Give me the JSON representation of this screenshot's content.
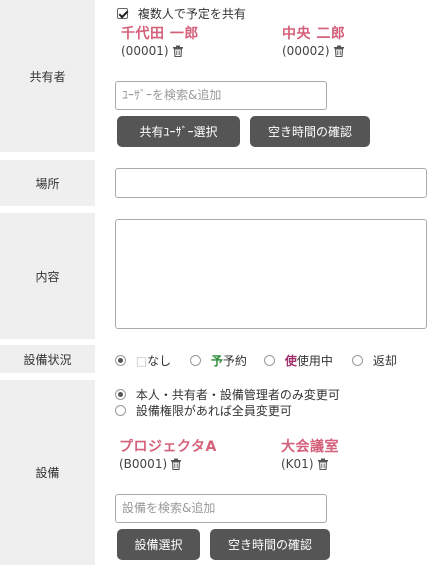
{
  "sharer": {
    "label": "共有者",
    "share_checkbox_label": "複数人で予定を共有",
    "people": [
      {
        "name": "千代田 一郎",
        "code": "(00001)"
      },
      {
        "name": "中央 二郎",
        "code": "(00002)"
      }
    ],
    "search_placeholder": "ﾕｰｻﾞｰを検索&追加",
    "select_button": "共有ﾕｰｻﾞｰ選択",
    "availability_button": "空き時間の確認"
  },
  "place": {
    "label": "場所",
    "value": ""
  },
  "content": {
    "label": "内容",
    "value": ""
  },
  "equipment_status": {
    "label": "設備状況",
    "options": [
      {
        "mark": "□",
        "text": "なし",
        "selected": true
      },
      {
        "mark": "予",
        "text": "予約",
        "selected": false,
        "color": "#2e8b3a"
      },
      {
        "mark": "使",
        "text": "使用中",
        "selected": false,
        "color": "#a0306e"
      },
      {
        "mark": "",
        "text": "返却",
        "selected": false
      }
    ]
  },
  "equipment": {
    "label": "設備",
    "permission_options": [
      {
        "text": "本人・共有者・設備管理者のみ変更可",
        "selected": true
      },
      {
        "text": "設備権限があれば全員変更可",
        "selected": false
      }
    ],
    "items": [
      {
        "name": "プロジェクタA",
        "code": "(B0001)"
      },
      {
        "name": "大会議室",
        "code": "(K01)"
      }
    ],
    "search_placeholder": "設備を検索&追加",
    "select_button": "設備選択",
    "availability_button": "空き時間の確認"
  },
  "colors": {
    "name_accent": "#d4607a",
    "button_bg": "#555555",
    "label_bg": "#efefef"
  }
}
